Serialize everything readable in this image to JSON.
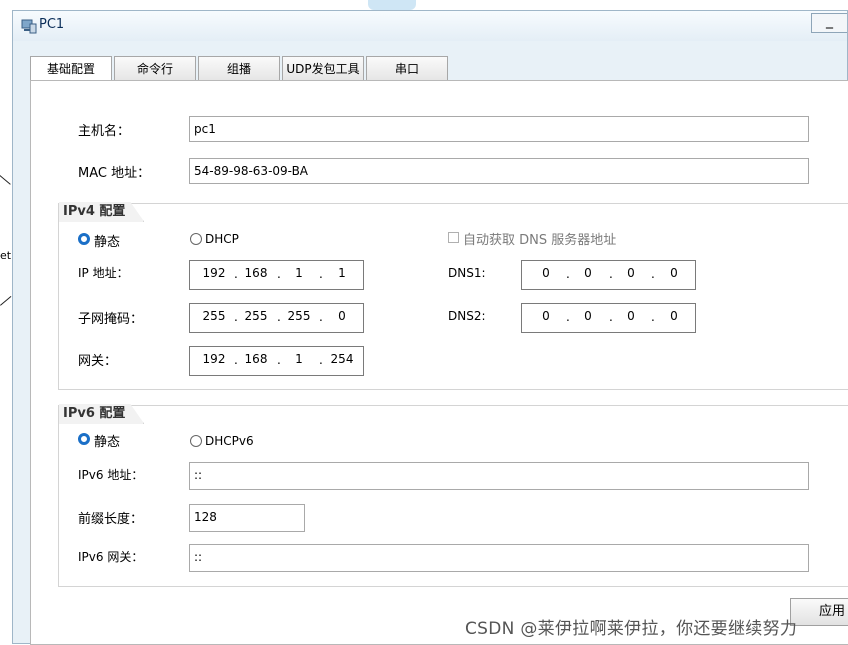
{
  "window": {
    "title": "PC1",
    "minimize_label": "_"
  },
  "background": {
    "partial_label": "et"
  },
  "tabs": [
    {
      "label": "基础配置"
    },
    {
      "label": "命令行"
    },
    {
      "label": "组播"
    },
    {
      "label": "UDP发包工具"
    },
    {
      "label": "串口"
    }
  ],
  "basic": {
    "hostname_label": "主机名：",
    "hostname_value": "pc1",
    "mac_label": "MAC 地址：",
    "mac_value": "54-89-98-63-09-BA"
  },
  "ipv4": {
    "section_title": "IPv4 配置",
    "static_label": "静态",
    "dhcp_label": "DHCP",
    "auto_dns_label": "自动获取 DNS 服务器地址",
    "ip_label": "IP 地址：",
    "ip": [
      "192",
      "168",
      "1",
      "1"
    ],
    "mask_label": "子网掩码：",
    "mask": [
      "255",
      "255",
      "255",
      "0"
    ],
    "gateway_label": "网关：",
    "gateway": [
      "192",
      "168",
      "1",
      "254"
    ],
    "dns1_label": "DNS1:",
    "dns1": [
      "0",
      "0",
      "0",
      "0"
    ],
    "dns2_label": "DNS2:",
    "dns2": [
      "0",
      "0",
      "0",
      "0"
    ]
  },
  "ipv6": {
    "section_title": "IPv6 配置",
    "static_label": "静态",
    "dhcp_label": "DHCPv6",
    "addr_label": "IPv6 地址：",
    "addr_value": "::",
    "prefix_label": "前缀长度：",
    "prefix_value": "128",
    "gateway_label": "IPv6 网关：",
    "gateway_value": "::"
  },
  "apply_label": "应用",
  "watermark": "CSDN @莱伊拉啊莱伊拉，你还要继续努力"
}
